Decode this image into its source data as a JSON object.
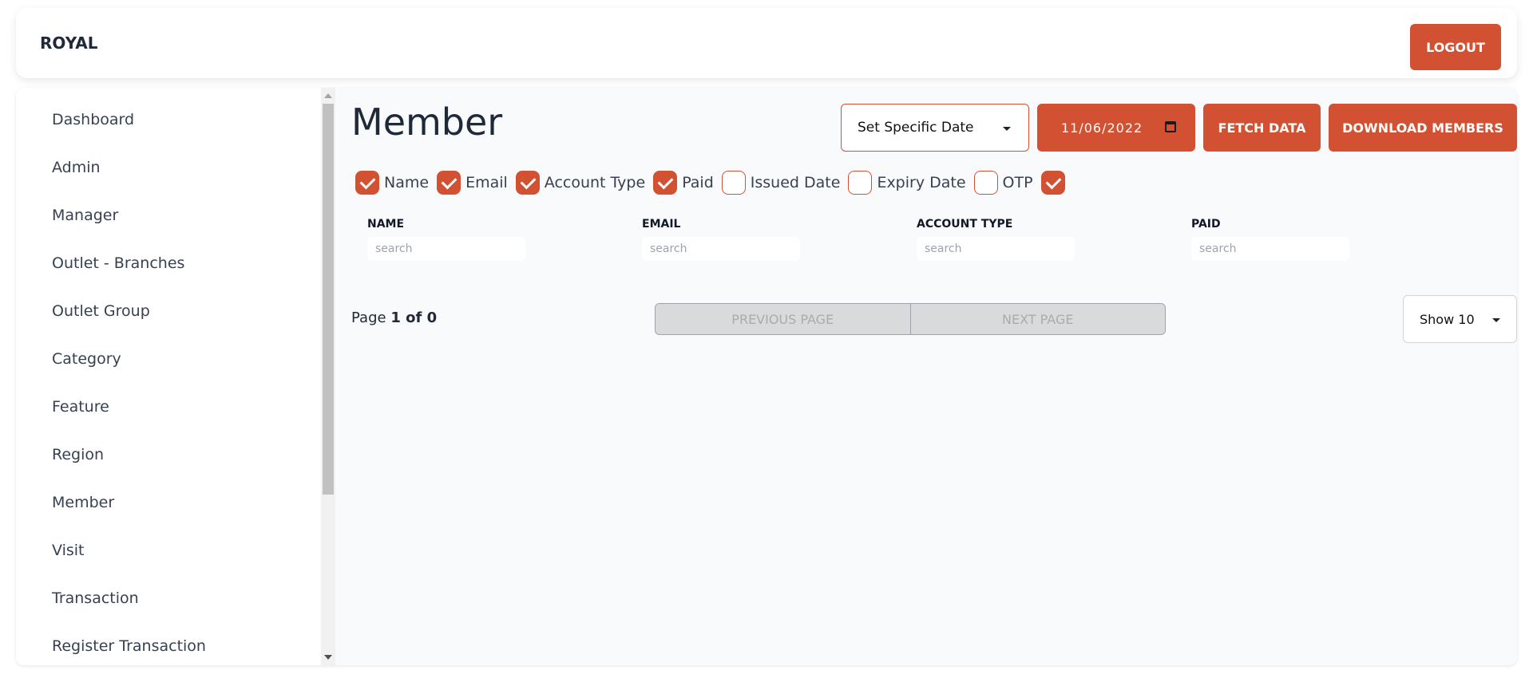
{
  "header": {
    "brand": "ROYAL",
    "logout_label": "LOGOUT"
  },
  "sidebar": {
    "items": [
      {
        "label": "Dashboard"
      },
      {
        "label": "Admin"
      },
      {
        "label": "Manager"
      },
      {
        "label": "Outlet - Branches"
      },
      {
        "label": "Outlet Group"
      },
      {
        "label": "Category"
      },
      {
        "label": "Feature"
      },
      {
        "label": "Region"
      },
      {
        "label": "Member"
      },
      {
        "label": "Visit"
      },
      {
        "label": "Transaction"
      },
      {
        "label": "Register Transaction"
      }
    ]
  },
  "main": {
    "title": "Member",
    "date_mode": "Set Specific Date",
    "date_value": "11/06/2022",
    "fetch_label": "FETCH DATA",
    "download_label": "DOWNLOAD MEMBERS",
    "filters": [
      {
        "label": "Name",
        "checked": true
      },
      {
        "label": "Email",
        "checked": true
      },
      {
        "label": "Account Type",
        "checked": true
      },
      {
        "label": "Paid",
        "checked": true
      },
      {
        "label": "Issued Date",
        "checked": false
      },
      {
        "label": "Expiry Date",
        "checked": false
      },
      {
        "label": "OTP",
        "checked": false
      },
      {
        "label": "",
        "checked": true
      }
    ],
    "columns": [
      {
        "header": "NAME",
        "placeholder": "search"
      },
      {
        "header": "EMAIL",
        "placeholder": "search"
      },
      {
        "header": "ACCOUNT TYPE",
        "placeholder": "search"
      },
      {
        "header": "PAID",
        "placeholder": "search"
      }
    ],
    "pagination": {
      "page_prefix": "Page",
      "page_value": "1 of 0",
      "previous_label": "PREVIOUS PAGE",
      "next_label": "NEXT PAGE",
      "show_label": "Show 10"
    }
  },
  "colors": {
    "accent": "#d35133",
    "disabled_bg": "#d9dadc",
    "disabled_text": "#a8abb0"
  }
}
